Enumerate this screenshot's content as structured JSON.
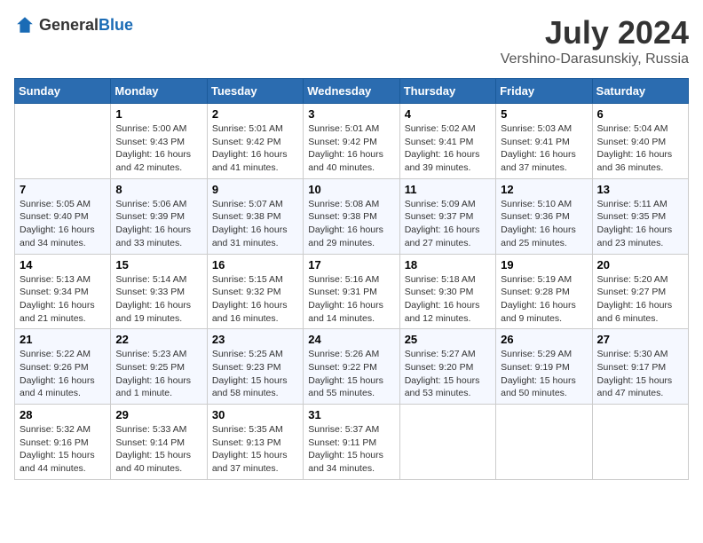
{
  "header": {
    "logo_general": "General",
    "logo_blue": "Blue",
    "month_year": "July 2024",
    "location": "Vershino-Darasunskiy, Russia"
  },
  "weekdays": [
    "Sunday",
    "Monday",
    "Tuesday",
    "Wednesday",
    "Thursday",
    "Friday",
    "Saturday"
  ],
  "weeks": [
    [
      {
        "day": "",
        "info": ""
      },
      {
        "day": "1",
        "info": "Sunrise: 5:00 AM\nSunset: 9:43 PM\nDaylight: 16 hours\nand 42 minutes."
      },
      {
        "day": "2",
        "info": "Sunrise: 5:01 AM\nSunset: 9:42 PM\nDaylight: 16 hours\nand 41 minutes."
      },
      {
        "day": "3",
        "info": "Sunrise: 5:01 AM\nSunset: 9:42 PM\nDaylight: 16 hours\nand 40 minutes."
      },
      {
        "day": "4",
        "info": "Sunrise: 5:02 AM\nSunset: 9:41 PM\nDaylight: 16 hours\nand 39 minutes."
      },
      {
        "day": "5",
        "info": "Sunrise: 5:03 AM\nSunset: 9:41 PM\nDaylight: 16 hours\nand 37 minutes."
      },
      {
        "day": "6",
        "info": "Sunrise: 5:04 AM\nSunset: 9:40 PM\nDaylight: 16 hours\nand 36 minutes."
      }
    ],
    [
      {
        "day": "7",
        "info": "Sunrise: 5:05 AM\nSunset: 9:40 PM\nDaylight: 16 hours\nand 34 minutes."
      },
      {
        "day": "8",
        "info": "Sunrise: 5:06 AM\nSunset: 9:39 PM\nDaylight: 16 hours\nand 33 minutes."
      },
      {
        "day": "9",
        "info": "Sunrise: 5:07 AM\nSunset: 9:38 PM\nDaylight: 16 hours\nand 31 minutes."
      },
      {
        "day": "10",
        "info": "Sunrise: 5:08 AM\nSunset: 9:38 PM\nDaylight: 16 hours\nand 29 minutes."
      },
      {
        "day": "11",
        "info": "Sunrise: 5:09 AM\nSunset: 9:37 PM\nDaylight: 16 hours\nand 27 minutes."
      },
      {
        "day": "12",
        "info": "Sunrise: 5:10 AM\nSunset: 9:36 PM\nDaylight: 16 hours\nand 25 minutes."
      },
      {
        "day": "13",
        "info": "Sunrise: 5:11 AM\nSunset: 9:35 PM\nDaylight: 16 hours\nand 23 minutes."
      }
    ],
    [
      {
        "day": "14",
        "info": "Sunrise: 5:13 AM\nSunset: 9:34 PM\nDaylight: 16 hours\nand 21 minutes."
      },
      {
        "day": "15",
        "info": "Sunrise: 5:14 AM\nSunset: 9:33 PM\nDaylight: 16 hours\nand 19 minutes."
      },
      {
        "day": "16",
        "info": "Sunrise: 5:15 AM\nSunset: 9:32 PM\nDaylight: 16 hours\nand 16 minutes."
      },
      {
        "day": "17",
        "info": "Sunrise: 5:16 AM\nSunset: 9:31 PM\nDaylight: 16 hours\nand 14 minutes."
      },
      {
        "day": "18",
        "info": "Sunrise: 5:18 AM\nSunset: 9:30 PM\nDaylight: 16 hours\nand 12 minutes."
      },
      {
        "day": "19",
        "info": "Sunrise: 5:19 AM\nSunset: 9:28 PM\nDaylight: 16 hours\nand 9 minutes."
      },
      {
        "day": "20",
        "info": "Sunrise: 5:20 AM\nSunset: 9:27 PM\nDaylight: 16 hours\nand 6 minutes."
      }
    ],
    [
      {
        "day": "21",
        "info": "Sunrise: 5:22 AM\nSunset: 9:26 PM\nDaylight: 16 hours\nand 4 minutes."
      },
      {
        "day": "22",
        "info": "Sunrise: 5:23 AM\nSunset: 9:25 PM\nDaylight: 16 hours\nand 1 minute."
      },
      {
        "day": "23",
        "info": "Sunrise: 5:25 AM\nSunset: 9:23 PM\nDaylight: 15 hours\nand 58 minutes."
      },
      {
        "day": "24",
        "info": "Sunrise: 5:26 AM\nSunset: 9:22 PM\nDaylight: 15 hours\nand 55 minutes."
      },
      {
        "day": "25",
        "info": "Sunrise: 5:27 AM\nSunset: 9:20 PM\nDaylight: 15 hours\nand 53 minutes."
      },
      {
        "day": "26",
        "info": "Sunrise: 5:29 AM\nSunset: 9:19 PM\nDaylight: 15 hours\nand 50 minutes."
      },
      {
        "day": "27",
        "info": "Sunrise: 5:30 AM\nSunset: 9:17 PM\nDaylight: 15 hours\nand 47 minutes."
      }
    ],
    [
      {
        "day": "28",
        "info": "Sunrise: 5:32 AM\nSunset: 9:16 PM\nDaylight: 15 hours\nand 44 minutes."
      },
      {
        "day": "29",
        "info": "Sunrise: 5:33 AM\nSunset: 9:14 PM\nDaylight: 15 hours\nand 40 minutes."
      },
      {
        "day": "30",
        "info": "Sunrise: 5:35 AM\nSunset: 9:13 PM\nDaylight: 15 hours\nand 37 minutes."
      },
      {
        "day": "31",
        "info": "Sunrise: 5:37 AM\nSunset: 9:11 PM\nDaylight: 15 hours\nand 34 minutes."
      },
      {
        "day": "",
        "info": ""
      },
      {
        "day": "",
        "info": ""
      },
      {
        "day": "",
        "info": ""
      }
    ]
  ]
}
